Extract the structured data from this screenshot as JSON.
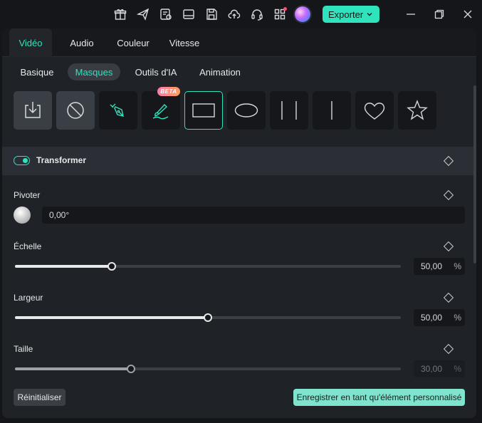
{
  "titlebar": {
    "icons": [
      "gift-icon",
      "send-icon",
      "checklist-icon",
      "layout-icon",
      "save-icon",
      "cloud-upload-icon",
      "headset-icon",
      "apps-grid-icon",
      "avatar"
    ],
    "export_label": "Exporter",
    "window_controls": [
      "minimize-icon",
      "restore-icon",
      "close-icon"
    ]
  },
  "tabs": [
    {
      "label": "Vidéo",
      "active": true
    },
    {
      "label": "Audio",
      "active": false
    },
    {
      "label": "Couleur",
      "active": false
    },
    {
      "label": "Vitesse",
      "active": false
    }
  ],
  "subtabs": [
    {
      "label": "Basique",
      "active": false
    },
    {
      "label": "Masques",
      "active": true
    },
    {
      "label": "Outils d'IA",
      "active": false
    },
    {
      "label": "Animation",
      "active": false
    }
  ],
  "masks": [
    {
      "icon": "import-mask-icon"
    },
    {
      "icon": "no-mask-icon"
    },
    {
      "icon": "pen-mask-icon"
    },
    {
      "icon": "brush-mask-icon",
      "badge": "BETA"
    },
    {
      "icon": "rectangle-mask-icon",
      "selected": true
    },
    {
      "icon": "ellipse-mask-icon"
    },
    {
      "icon": "double-line-mask-icon"
    },
    {
      "icon": "single-line-mask-icon"
    },
    {
      "icon": "heart-mask-icon"
    },
    {
      "icon": "star-mask-icon"
    }
  ],
  "transform": {
    "label": "Transformer",
    "enabled": true
  },
  "properties": {
    "rotate": {
      "label": "Pivoter",
      "value": "0,00°"
    },
    "scale": {
      "label": "Échelle",
      "value": "50,00",
      "unit": "%",
      "fraction": 0.25
    },
    "width": {
      "label": "Largeur",
      "value": "50,00",
      "unit": "%",
      "fraction": 0.5
    },
    "size": {
      "label": "Taille",
      "value": "30,00",
      "unit": "%",
      "fraction": 0.3
    }
  },
  "footer": {
    "reset_label": "Réinitialiser",
    "save_label": "Enregistrer en tant qu'élément personnalisé"
  },
  "colors": {
    "accent": "#2fe3bd",
    "panel": "#1f2227",
    "background": "#141619"
  }
}
